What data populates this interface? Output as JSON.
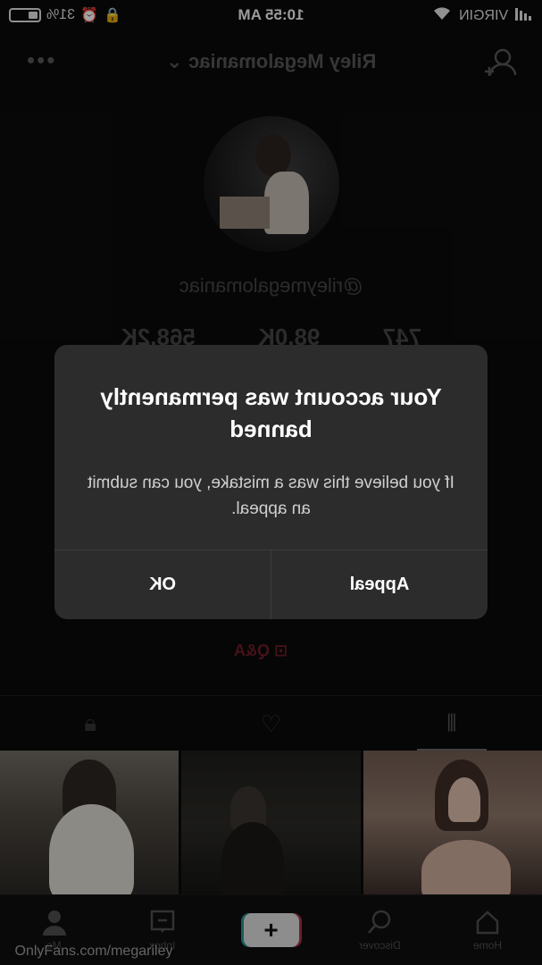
{
  "status_bar": {
    "carrier": "VIRGIN",
    "time": "10:55 AM",
    "battery": "31%"
  },
  "header": {
    "title": "Riley Megalomaniac",
    "more_icon": "more-horizontal-icon",
    "add_user_icon": "add-user-icon",
    "dropdown_icon": "chevron-down-icon"
  },
  "profile": {
    "handle": "@rileymegalomaniac",
    "stats": [
      "747",
      "98.0K",
      "568.2K"
    ]
  },
  "bio": {
    "qa_label": "Q&A"
  },
  "tabs": [
    "grid-icon",
    "liked-icon",
    "lock-icon"
  ],
  "modal": {
    "title": "Your account was permanently banned",
    "body": "If you believe this was a mistake, you can submit an appeal.",
    "appeal_label": "Appeal",
    "ok_label": "OK"
  },
  "nav": {
    "home": "Home",
    "discover": "Discover",
    "inbox": "Inbox",
    "me": "Me"
  },
  "watermark": "OnlyFans.com/megariley",
  "colors": {
    "background": "#0a0a0a",
    "modal": "#2c2c2c",
    "qa_accent": "#6b1d25",
    "plus_teal": "#2a8f8f",
    "plus_red": "#a3304a"
  }
}
